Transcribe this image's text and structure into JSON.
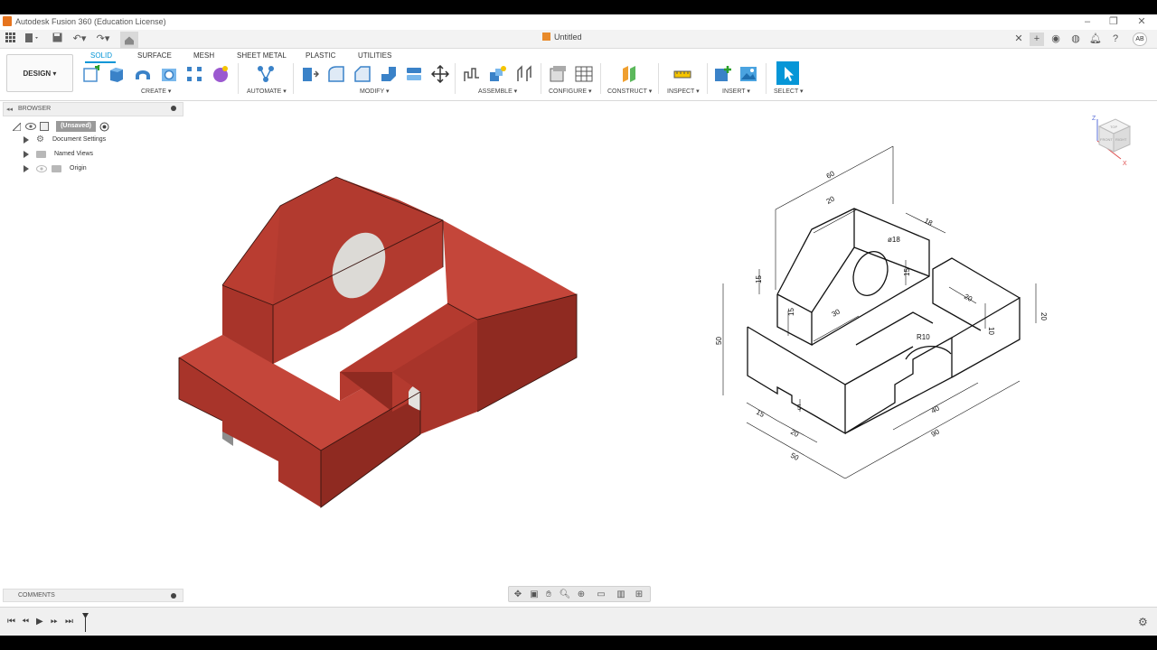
{
  "window": {
    "title": "Autodesk Fusion 360 (Education License)",
    "document_tab": "Untitled"
  },
  "ribbon": {
    "workspace": "DESIGN ▾",
    "tabs": [
      "SOLID",
      "SURFACE",
      "MESH",
      "SHEET METAL",
      "PLASTIC",
      "UTILITIES"
    ],
    "active_tab": "SOLID",
    "groups": [
      "CREATE ▾",
      "AUTOMATE ▾",
      "MODIFY ▾",
      "ASSEMBLE ▾",
      "CONFIGURE ▾",
      "CONSTRUCT ▾",
      "INSPECT ▾",
      "INSERT ▾",
      "SELECT ▾"
    ]
  },
  "browser": {
    "header": "BROWSER",
    "root": "(Unsaved)",
    "items": [
      "Document Settings",
      "Named Views",
      "Origin"
    ]
  },
  "comments": {
    "header": "COMMENTS"
  },
  "viewcube": {
    "top": "TOP",
    "front": "FRONT",
    "right": "RIGHT",
    "axis_z": "Z",
    "axis_x": "X"
  },
  "drawing": {
    "dims": [
      "60",
      "20",
      "18",
      "ø18",
      "15",
      "15",
      "15",
      "30",
      "50",
      "20",
      "20",
      "10",
      "R10",
      "15",
      "5",
      "20",
      "40",
      "90",
      "50"
    ]
  },
  "colors": {
    "accent": "#0696d7",
    "part": "#b73a2e",
    "part_dark": "#8f2a21",
    "part_light": "#c4463a"
  }
}
